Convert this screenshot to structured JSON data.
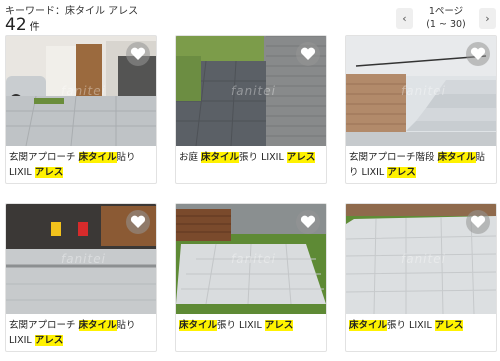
{
  "header": {
    "keyword_label": "キーワード：床タイル アレス",
    "count": "42",
    "count_unit": "件"
  },
  "pager": {
    "prev_icon": "chevron-left-icon",
    "next_icon": "chevron-right-icon",
    "page_label": "1ページ",
    "range_label": "(1 ~ 30)"
  },
  "cards": [
    {
      "pre": "玄関アプローチ ",
      "hl1": "床タイル",
      "mid": "貼り LIXIL ",
      "hl2": "アレス",
      "post": ""
    },
    {
      "pre": "お庭 ",
      "hl1": "床タイル",
      "mid": "張り LIXIL ",
      "hl2": "アレス",
      "post": ""
    },
    {
      "pre": "玄関アプローチ階段 ",
      "hl1": "床タイル",
      "mid": "貼り LIXIL ",
      "hl2": "アレス",
      "post": ""
    },
    {
      "pre": "玄関アプローチ ",
      "hl1": "床タイル",
      "mid": "貼り LIXIL ",
      "hl2": "アレス",
      "post": ""
    },
    {
      "pre": "",
      "hl1": "床タイル",
      "mid": "張り LIXIL ",
      "hl2": "アレス",
      "post": ""
    },
    {
      "pre": "",
      "hl1": "床タイル",
      "mid": "張り LIXIL ",
      "hl2": "アレス",
      "post": ""
    }
  ],
  "watermark_text": "fanitei",
  "colors": {
    "highlight": "#fff200",
    "heart_bg": "#969696"
  }
}
